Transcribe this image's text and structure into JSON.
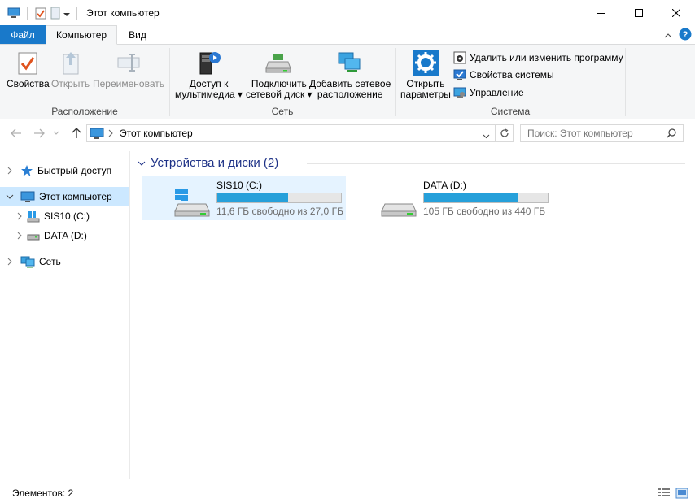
{
  "window": {
    "title": "Этот компьютер"
  },
  "ribbon_tabs": {
    "file": "Файл",
    "computer": "Компьютер",
    "view": "Вид"
  },
  "ribbon": {
    "location": {
      "label": "Расположение",
      "properties": "Свойства",
      "open": "Открыть",
      "rename": "Переименовать"
    },
    "network": {
      "label": "Сеть",
      "media_line1": "Доступ к",
      "media_line2": "мультимедиа",
      "map_line1": "Подключить",
      "map_line2": "сетевой диск",
      "add_line1": "Добавить сетевое",
      "add_line2": "расположение"
    },
    "system": {
      "label": "Система",
      "open_line1": "Открыть",
      "open_line2": "параметры",
      "uninstall": "Удалить или изменить программу",
      "properties": "Свойства системы",
      "manage": "Управление"
    }
  },
  "address": {
    "path": "Этот компьютер",
    "search_placeholder": "Поиск: Этот компьютер"
  },
  "nav": {
    "quick_access": "Быстрый доступ",
    "this_pc": "Этот компьютер",
    "drive_c": "SIS10 (C:)",
    "drive_d": "DATA (D:)",
    "network": "Сеть"
  },
  "content": {
    "group_title": "Устройства и диски (2)",
    "drives": [
      {
        "name": "SIS10 (C:)",
        "free_text": "11,6 ГБ свободно из 27,0 ГБ",
        "used_fraction": 0.57
      },
      {
        "name": "DATA (D:)",
        "free_text": "105 ГБ свободно из 440 ГБ",
        "used_fraction": 0.76
      }
    ]
  },
  "status": {
    "items": "Элементов: 2"
  },
  "colors": {
    "accent": "#1979ca",
    "bar_fill": "#26a0da",
    "selected": "#cce8ff",
    "group_title": "#1e3287"
  }
}
